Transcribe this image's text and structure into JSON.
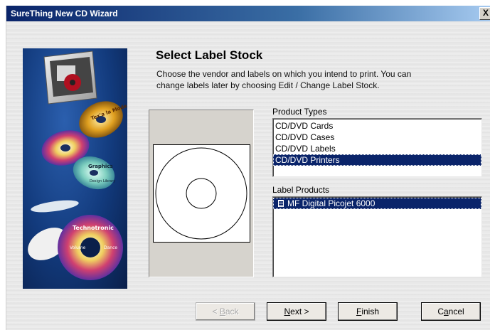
{
  "window": {
    "title": "SureThing New CD Wizard",
    "close_glyph": "X"
  },
  "page": {
    "heading": "Select Label Stock",
    "description": "Choose the vendor and labels on which you intend to print. You can change labels later by choosing Edit / Change Label Stock."
  },
  "product_types": {
    "label": "Product Types",
    "items": [
      "CD/DVD Cards",
      "CD/DVD Cases",
      "CD/DVD Labels",
      "CD/DVD Printers"
    ],
    "selected": "CD/DVD Printers"
  },
  "label_products": {
    "label": "Label Products",
    "items": [
      "MF Digital Picojet 6000"
    ],
    "selected": "MF Digital Picojet 6000",
    "item_icon": "document-icon"
  },
  "buttons": {
    "back": {
      "label": "Back",
      "accel": "B",
      "prefix": "< ",
      "enabled": false
    },
    "next": {
      "label": "Next",
      "accel": "N",
      "suffix": " >",
      "enabled": true
    },
    "finish": {
      "label": "Finish",
      "accel": "F",
      "enabled": true
    },
    "cancel": {
      "label": "Cancel",
      "accel": "a",
      "enabled": true
    }
  },
  "banner": {
    "disc_texts": [
      "Technotronic",
      "Volume",
      "Dance",
      "Graphics",
      "Design Library",
      "Tex'a la Mode"
    ]
  },
  "colors": {
    "selection": "#0a246a",
    "titlebar": "#0a246a"
  }
}
